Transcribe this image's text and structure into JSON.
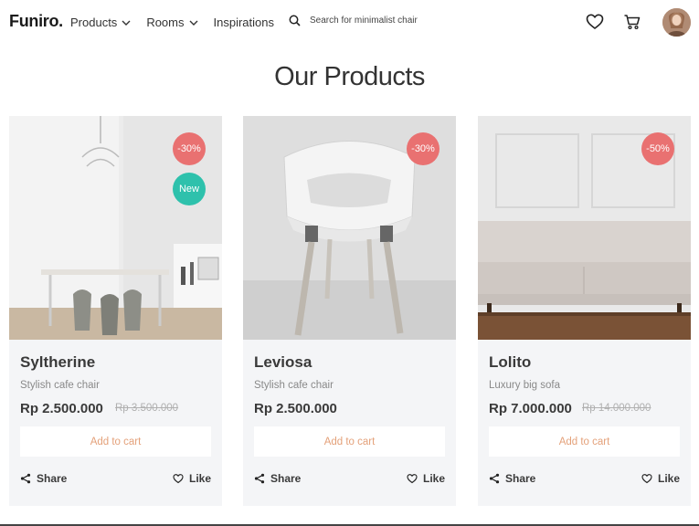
{
  "header": {
    "logo": "Funiro.",
    "nav": [
      {
        "label": "Products",
        "has_dropdown": true
      },
      {
        "label": "Rooms",
        "has_dropdown": true
      },
      {
        "label": "Inspirations",
        "has_dropdown": false
      }
    ],
    "search_placeholder": "Search for minimalist chair",
    "icons": [
      "search-icon",
      "heart-icon",
      "cart-icon",
      "avatar"
    ]
  },
  "page": {
    "title": "Our Products"
  },
  "products": [
    {
      "name": "Syltherine",
      "description": "Stylish cafe chair",
      "price": "Rp 2.500.000",
      "old_price": "Rp 3.500.000",
      "discount_badge": "-30%",
      "new_badge": "New",
      "add_to_cart": "Add to cart",
      "share": "Share",
      "like": "Like"
    },
    {
      "name": "Leviosa",
      "description": "Stylish cafe chair",
      "price": "Rp 2.500.000",
      "discount_badge": "-30%",
      "add_to_cart": "Add to cart",
      "share": "Share",
      "like": "Like"
    },
    {
      "name": "Lolito",
      "description": "Luxury big sofa",
      "price": "Rp 7.000.000",
      "old_price": "Rp 14.000.000",
      "discount_badge": "-50%",
      "add_to_cart": "Add to cart",
      "share": "Share",
      "like": "Like"
    }
  ],
  "colors": {
    "discount": "#e97171",
    "new": "#2ec1ac",
    "accent": "#e4a17a",
    "card_bg": "#f4f5f7"
  }
}
